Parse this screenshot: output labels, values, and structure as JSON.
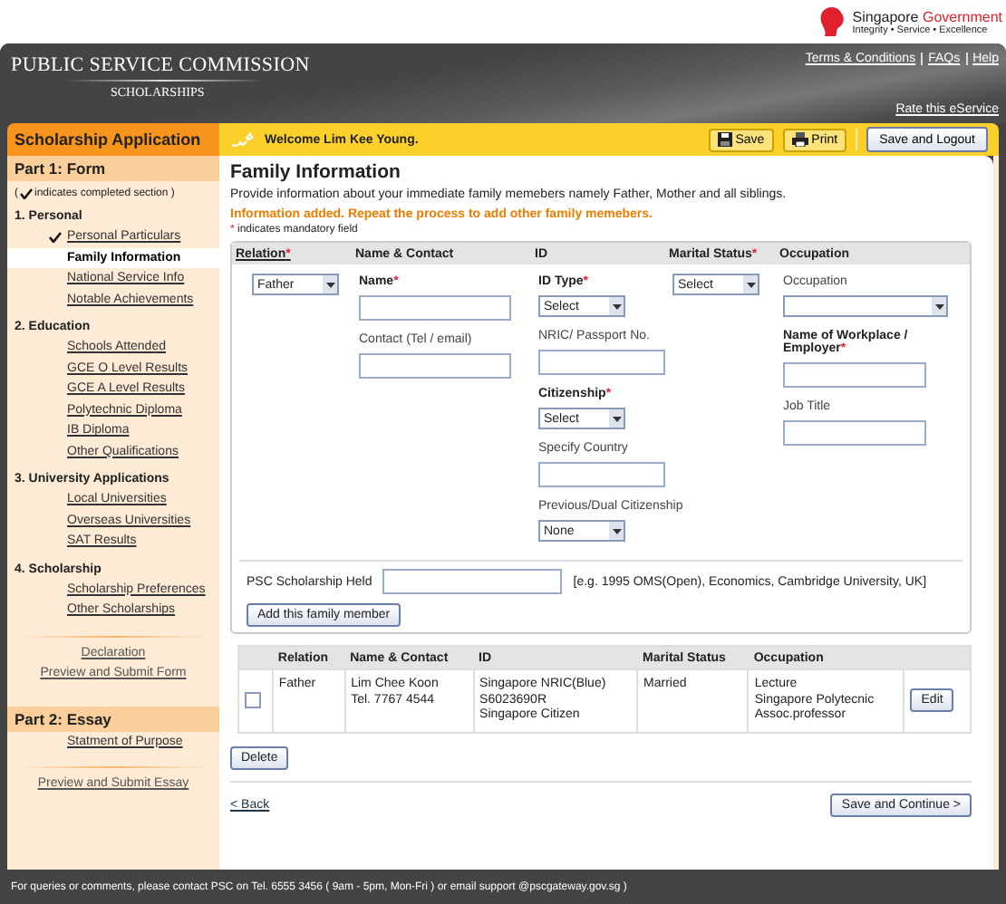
{
  "gov_logo": {
    "name": "Singapore",
    "highlight": "Government",
    "tagline": "Integrity • Service • Excellence"
  },
  "header": {
    "title": "PUBLIC SERVICE COMMISSION",
    "subtitle": "SCHOLARSHIPS",
    "links": [
      "Terms & Conditions",
      "FAQs",
      "Help"
    ],
    "rate_link": "Rate this eService"
  },
  "app_bar": {
    "title": "Scholarship Application",
    "welcome": "Welcome Lim Kee Young.",
    "buttons": [
      {
        "label": "Save",
        "kind": "save"
      },
      {
        "label": "Print",
        "kind": "print"
      },
      {
        "label": "Save and Logout",
        "kind": "plain"
      }
    ]
  },
  "sidebar": {
    "parts": [
      {
        "title": "Part 1: Form",
        "legend": {
          "open": "(",
          "text": "indicates completed section )"
        },
        "groups": [
          {
            "title": "1. Personal",
            "items": [
              {
                "label": "Personal Particulars",
                "completed": true,
                "selected": false
              },
              {
                "label": "Family Information",
                "completed": false,
                "selected": true
              },
              {
                "label": "National Service Info",
                "completed": false,
                "selected": false
              },
              {
                "label": "Notable Achievements",
                "completed": false,
                "selected": false
              }
            ]
          },
          {
            "title": "2. Education",
            "items": [
              {
                "label": "Schools Attended",
                "completed": false,
                "selected": false
              },
              {
                "label": "GCE O Level Results",
                "completed": false,
                "selected": false
              },
              {
                "label": "GCE A Level Results",
                "completed": false,
                "selected": false
              },
              {
                "label": "Polytechnic Diploma",
                "completed": false,
                "selected": false
              },
              {
                "label": "IB Diploma",
                "completed": false,
                "selected": false
              },
              {
                "label": "Other Qualifications",
                "completed": false,
                "selected": false
              }
            ]
          },
          {
            "title": "3. University Applications",
            "items": [
              {
                "label": "Local Universities",
                "completed": false,
                "selected": false
              },
              {
                "label": "Overseas Universities",
                "completed": false,
                "selected": false
              },
              {
                "label": "SAT Results",
                "completed": false,
                "selected": false
              }
            ]
          },
          {
            "title": "4. Scholarship",
            "items": [
              {
                "label": "Scholarship Preferences",
                "completed": false,
                "selected": false
              },
              {
                "label": "Other Scholarships",
                "completed": false,
                "selected": false
              }
            ]
          }
        ],
        "links": [
          "Declaration",
          "Preview and Submit Form"
        ]
      },
      {
        "title": "Part 2: Essay",
        "groups": [
          {
            "items": [
              {
                "label": "Statment of Purpose",
                "completed": false,
                "selected": false
              }
            ]
          }
        ],
        "links": [
          "Preview and Submit Essay"
        ]
      }
    ]
  },
  "main": {
    "heading": "Family Information",
    "intro": "Provide information about your immediate family memebers namely Father, Mother and all siblings.",
    "notice": "Information added. Repeat the process to add other family memebers.",
    "mandatory": {
      "mark": "*",
      "text": "indicates mandatory field"
    },
    "form": {
      "columns": [
        {
          "heading": "Relation",
          "required": true,
          "fields": [
            {
              "kind": "select",
              "value": "Father"
            }
          ]
        },
        {
          "heading": "Name & Contact",
          "required": false,
          "fields": [
            {
              "kind": "text",
              "label": "Name",
              "bold": true,
              "required": true
            },
            {
              "kind": "text",
              "label": "Contact (Tel / email)",
              "bold": false,
              "required": false
            }
          ]
        },
        {
          "heading": "ID",
          "required": false,
          "fields": [
            {
              "kind": "select",
              "label": "ID Type",
              "bold": true,
              "required": true,
              "value": "Select"
            },
            {
              "kind": "text",
              "label": "NRIC/ Passport No.",
              "bold": false,
              "required": false
            },
            {
              "kind": "select",
              "label": "Citizenship",
              "bold": true,
              "required": true,
              "value": "Select"
            },
            {
              "kind": "text",
              "label": "Specify Country",
              "bold": false,
              "required": false
            },
            {
              "kind": "select",
              "label": "Previous/Dual Citizenship",
              "bold": false,
              "required": false,
              "value": "None"
            }
          ]
        },
        {
          "heading": "Marital Status",
          "required": true,
          "fields": [
            {
              "kind": "select",
              "value": "Select"
            }
          ]
        },
        {
          "heading": "Occupation",
          "required": false,
          "fields": [
            {
              "kind": "select",
              "label": "Occupation",
              "bold": false,
              "required": false
            },
            {
              "kind": "text",
              "label": "Name of Workplace / Employer",
              "bold": true,
              "required": true
            },
            {
              "kind": "text",
              "label": "Job Title",
              "bold": false,
              "required": false
            }
          ]
        }
      ],
      "scholarship_label": "PSC Scholarship Held",
      "scholarship_hint": "[e.g. 1995 OMS(Open), Economics, Cambridge University, UK]",
      "add_button": "Add this family member"
    },
    "table": {
      "columns": [
        "Relation",
        "Name & Contact",
        "ID",
        "Marital Status",
        "Occupation"
      ],
      "rows": [
        {
          "selected": false,
          "cells": [
            [
              "Father"
            ],
            [
              "Lim Chee Koon",
              "Tel. 7767 4544"
            ],
            [
              "Singapore NRIC(Blue)",
              "S6023690R",
              "Singapore Citizen"
            ],
            [
              "Married"
            ],
            [
              "Lecture",
              "Singapore Polytecnic",
              "Assoc.professor"
            ]
          ],
          "action": "Edit"
        }
      ]
    },
    "delete_button": "Delete",
    "back_link": "< Back",
    "continue_button": "Save and Continue >"
  },
  "footer": "For queries or comments, please contact PSC on Tel. 6555 3456 ( 9am - 5pm, Mon-Fri ) or email support @pscgateway.gov.sg )"
}
